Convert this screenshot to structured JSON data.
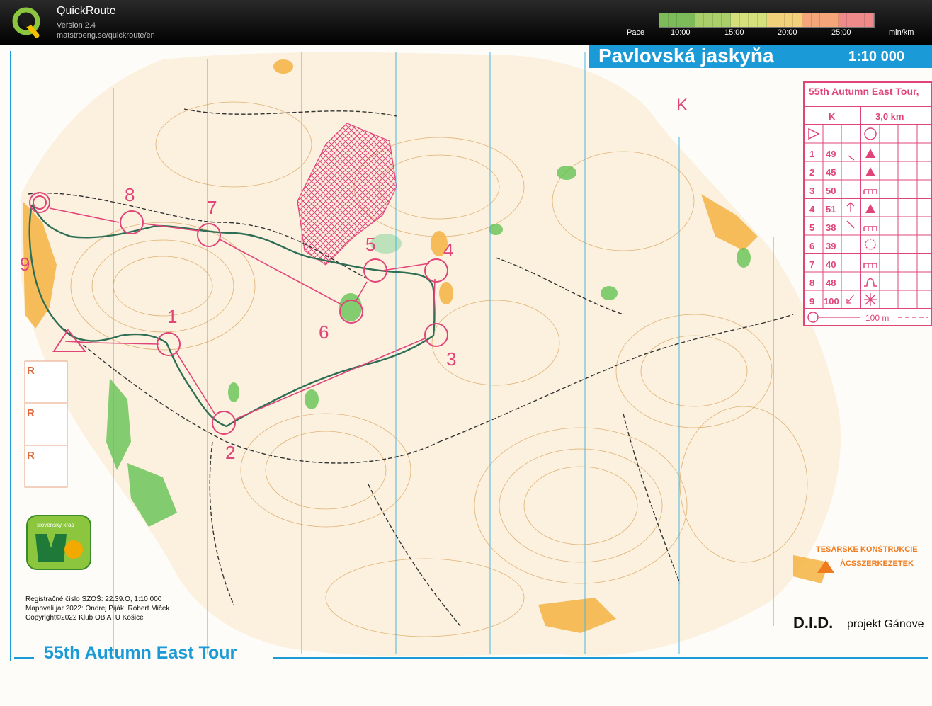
{
  "app": {
    "title": "QuickRoute",
    "version": "Version 2.4",
    "url": "matstroeng.se/quickroute/en"
  },
  "pace": {
    "label": "Pace",
    "ticks": [
      "10:00",
      "15:00",
      "20:00",
      "25:00"
    ],
    "unit": "min/km",
    "colors": [
      "#7dbb5a",
      "#a9cf6a",
      "#d6e07a",
      "#f1d27a",
      "#f4a57a",
      "#ee8a8a"
    ]
  },
  "map": {
    "header_title": "Pavlovská jaskyňa",
    "header_scale": "1:10 000",
    "course_letter": "K",
    "colors": {
      "course": "#e0457a",
      "route": "#2d6e55",
      "header": "#1a9ad6"
    },
    "controls": [
      {
        "label": "1"
      },
      {
        "label": "2"
      },
      {
        "label": "3"
      },
      {
        "label": "4"
      },
      {
        "label": "5"
      },
      {
        "label": "6"
      },
      {
        "label": "7"
      },
      {
        "label": "8"
      },
      {
        "label": "9"
      }
    ],
    "description_sheet": {
      "event": "55th Autumn East Tour,",
      "course": "K",
      "length": "3,0 km",
      "rows": [
        {
          "n": "1",
          "code": "49"
        },
        {
          "n": "2",
          "code": "45"
        },
        {
          "n": "3",
          "code": "50"
        },
        {
          "n": "4",
          "code": "51"
        },
        {
          "n": "5",
          "code": "38"
        },
        {
          "n": "6",
          "code": "39"
        },
        {
          "n": "7",
          "code": "40"
        },
        {
          "n": "8",
          "code": "48"
        },
        {
          "n": "9",
          "code": "100"
        }
      ],
      "finish_distance": "100 m"
    },
    "refreshment_marks": [
      "R",
      "R",
      "R"
    ],
    "logo_text": "slovenský kras",
    "credits": [
      "Registračné číslo SZOŠ: 22.39.O, 1:10 000",
      "Mapovali jar 2022: Ondrej Piják, Róbert Miček",
      "Copyright©2022 Klub OB ATU Košice"
    ],
    "event_title": "55th Autumn East Tour",
    "sponsor_line1": "TESÁRSKE KONŠTRUKCIE",
    "sponsor_line2": "ÁCSSZERKEZETEK",
    "did_text": "D.I.D.",
    "project_text": "projekt Gánove"
  }
}
